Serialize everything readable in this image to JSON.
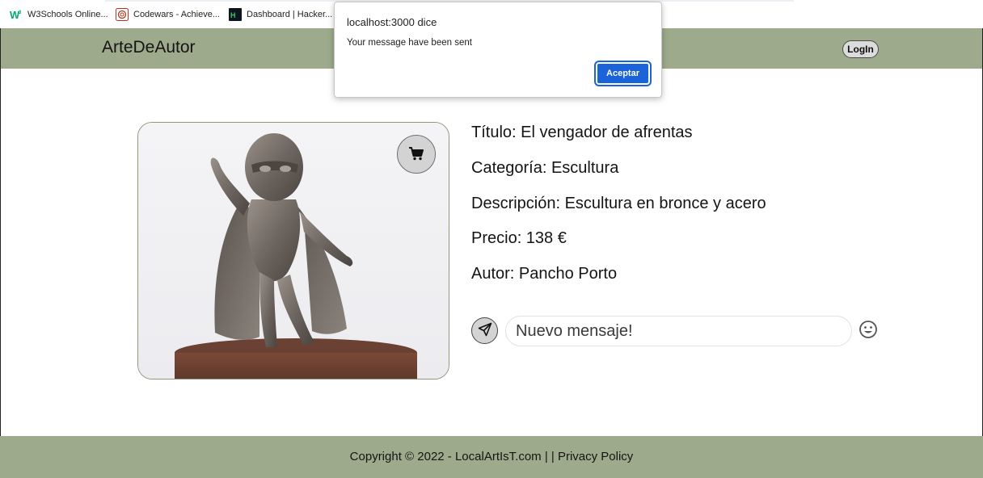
{
  "bookmarks": [
    {
      "label": "W3Schools Online...",
      "icon": "w3schools-icon"
    },
    {
      "label": "Codewars - Achieve...",
      "icon": "codewars-icon"
    },
    {
      "label": "Dashboard | Hacker...",
      "icon": "hackerrank-icon"
    }
  ],
  "nav": {
    "brand": "ArteDeAutor",
    "login_label": "LogIn"
  },
  "product": {
    "titulo": "Título: El vengador de afrentas",
    "categoria": "Categoría: Escultura",
    "descripcion": "Descripción: Escultura en bronce y acero",
    "precio": "Precio: 138 €",
    "autor": "Autor: Pancho Porto"
  },
  "message": {
    "placeholder": "Nuevo mensaje!"
  },
  "footer": {
    "text": "Copyright © 2022 - LocalArtIsT.com | | Privacy Policy"
  },
  "dialog": {
    "title": "localhost:3000 dice",
    "message": "Your message have been sent",
    "ok_label": "Aceptar"
  },
  "colors": {
    "nav_bg": "#9dab8c",
    "dialog_button": "#1a63d9"
  }
}
